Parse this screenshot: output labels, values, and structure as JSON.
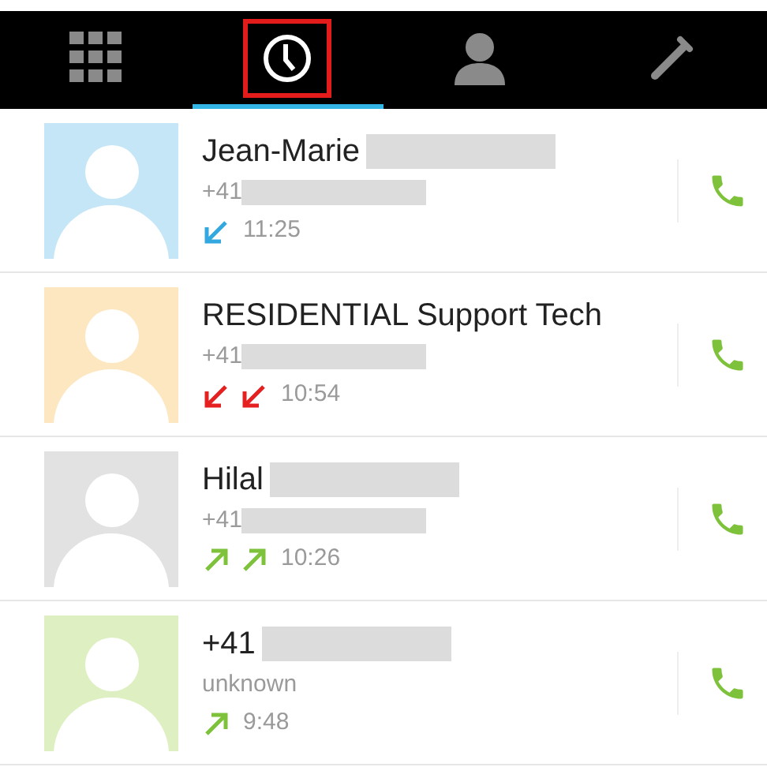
{
  "tabs": [
    {
      "kind": "dialpad",
      "selected": false,
      "highlighted": false
    },
    {
      "kind": "recent",
      "selected": true,
      "highlighted": true
    },
    {
      "kind": "contacts",
      "selected": false,
      "highlighted": false
    },
    {
      "kind": "settings",
      "selected": false,
      "highlighted": false
    }
  ],
  "calls": [
    {
      "name": "Jean-Marie",
      "name_redacted": true,
      "detail": "+41",
      "detail_redacted": true,
      "time": "11:25",
      "color": "#c5e6f7",
      "arrows": [
        {
          "kind": "incoming"
        }
      ]
    },
    {
      "name": "RESIDENTIAL Support Tech",
      "name_redacted": false,
      "detail": "+41",
      "detail_redacted": true,
      "time": "10:54",
      "color": "#fde7c0",
      "arrows": [
        {
          "kind": "missed"
        },
        {
          "kind": "missed"
        }
      ]
    },
    {
      "name": "Hilal",
      "name_redacted": true,
      "detail": "+41",
      "detail_redacted": true,
      "time": "10:26",
      "color": "#e2e2e2",
      "arrows": [
        {
          "kind": "outgoing"
        },
        {
          "kind": "outgoing"
        }
      ]
    },
    {
      "name": "+41",
      "name_redacted": true,
      "detail": "unknown",
      "detail_redacted": false,
      "time": "9:48",
      "color": "#def0c2",
      "arrows": [
        {
          "kind": "outgoing"
        }
      ]
    }
  ]
}
